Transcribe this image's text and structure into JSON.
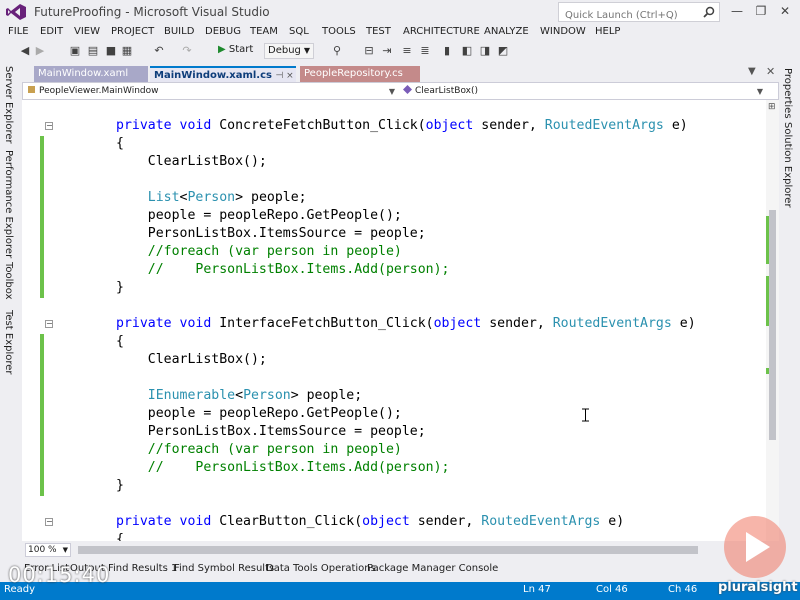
{
  "window": {
    "title": "FutureProofing - Microsoft Visual Studio",
    "quick_launch_placeholder": "Quick Launch (Ctrl+Q)",
    "minimize": "—",
    "maximize": "❐",
    "close": "✕"
  },
  "menu": [
    "FILE",
    "EDIT",
    "VIEW",
    "PROJECT",
    "BUILD",
    "DEBUG",
    "TEAM",
    "SQL",
    "TOOLS",
    "TEST",
    "ARCHITECTURE",
    "ANALYZE",
    "WINDOW",
    "HELP"
  ],
  "toolbar": {
    "start_label": "Start",
    "config": "Debug"
  },
  "left_tools": [
    "Server Explorer",
    "Performance Explorer",
    "Toolbox",
    "Test Explorer"
  ],
  "right_tools": [
    "Properties",
    "Solution Explorer"
  ],
  "tabs": [
    "MainWindow.xaml",
    "MainWindow.xaml.cs",
    "PeopleRepository.cs"
  ],
  "tab_pin": "⊣ ×",
  "navbar": {
    "class": "PeopleViewer.MainWindow",
    "member": "ClearListBox()"
  },
  "code": [
    {
      "t": "private void ConcreteFetchButton_Click(object sender, RoutedEventArgs e)"
    },
    {
      "t": "{"
    },
    {
      "t": "    ClearListBox();"
    },
    {
      "t": ""
    },
    {
      "t": "    List<Person> people;"
    },
    {
      "t": "    people = peopleRepo.GetPeople();"
    },
    {
      "t": "    PersonListBox.ItemsSource = people;"
    },
    {
      "t": "    //foreach (var person in people)"
    },
    {
      "t": "    //    PersonListBox.Items.Add(person);"
    },
    {
      "t": "}"
    },
    {
      "t": ""
    },
    {
      "t": "private void InterfaceFetchButton_Click(object sender, RoutedEventArgs e)"
    },
    {
      "t": "{"
    },
    {
      "t": "    ClearListBox();"
    },
    {
      "t": ""
    },
    {
      "t": "    IEnumerable<Person> people;"
    },
    {
      "t": "    people = peopleRepo.GetPeople();"
    },
    {
      "t": "    PersonListBox.ItemsSource = people;"
    },
    {
      "t": "    //foreach (var person in people)"
    },
    {
      "t": "    //    PersonListBox.Items.Add(person);"
    },
    {
      "t": "}"
    },
    {
      "t": ""
    },
    {
      "t": "private void ClearButton_Click(object sender, RoutedEventArgs e)"
    },
    {
      "t": "{"
    }
  ],
  "zoom": "100 %",
  "bottom_tabs": [
    "Error List",
    "Output",
    "Find Results 1",
    "Find Symbol Results",
    "Data Tools Operations",
    "Package Manager Console"
  ],
  "status": {
    "ready": "Ready",
    "line": "Ln 47",
    "col": "Col 46",
    "ch": "Ch 46"
  },
  "video": {
    "timestamp": "00:15:40",
    "brand": "pluralsight"
  },
  "colors": {
    "status_bar": "#007acc",
    "keyword": "#0000ff",
    "type": "#2b91af",
    "comment": "#008000",
    "change_bar": "#6cc24a"
  }
}
